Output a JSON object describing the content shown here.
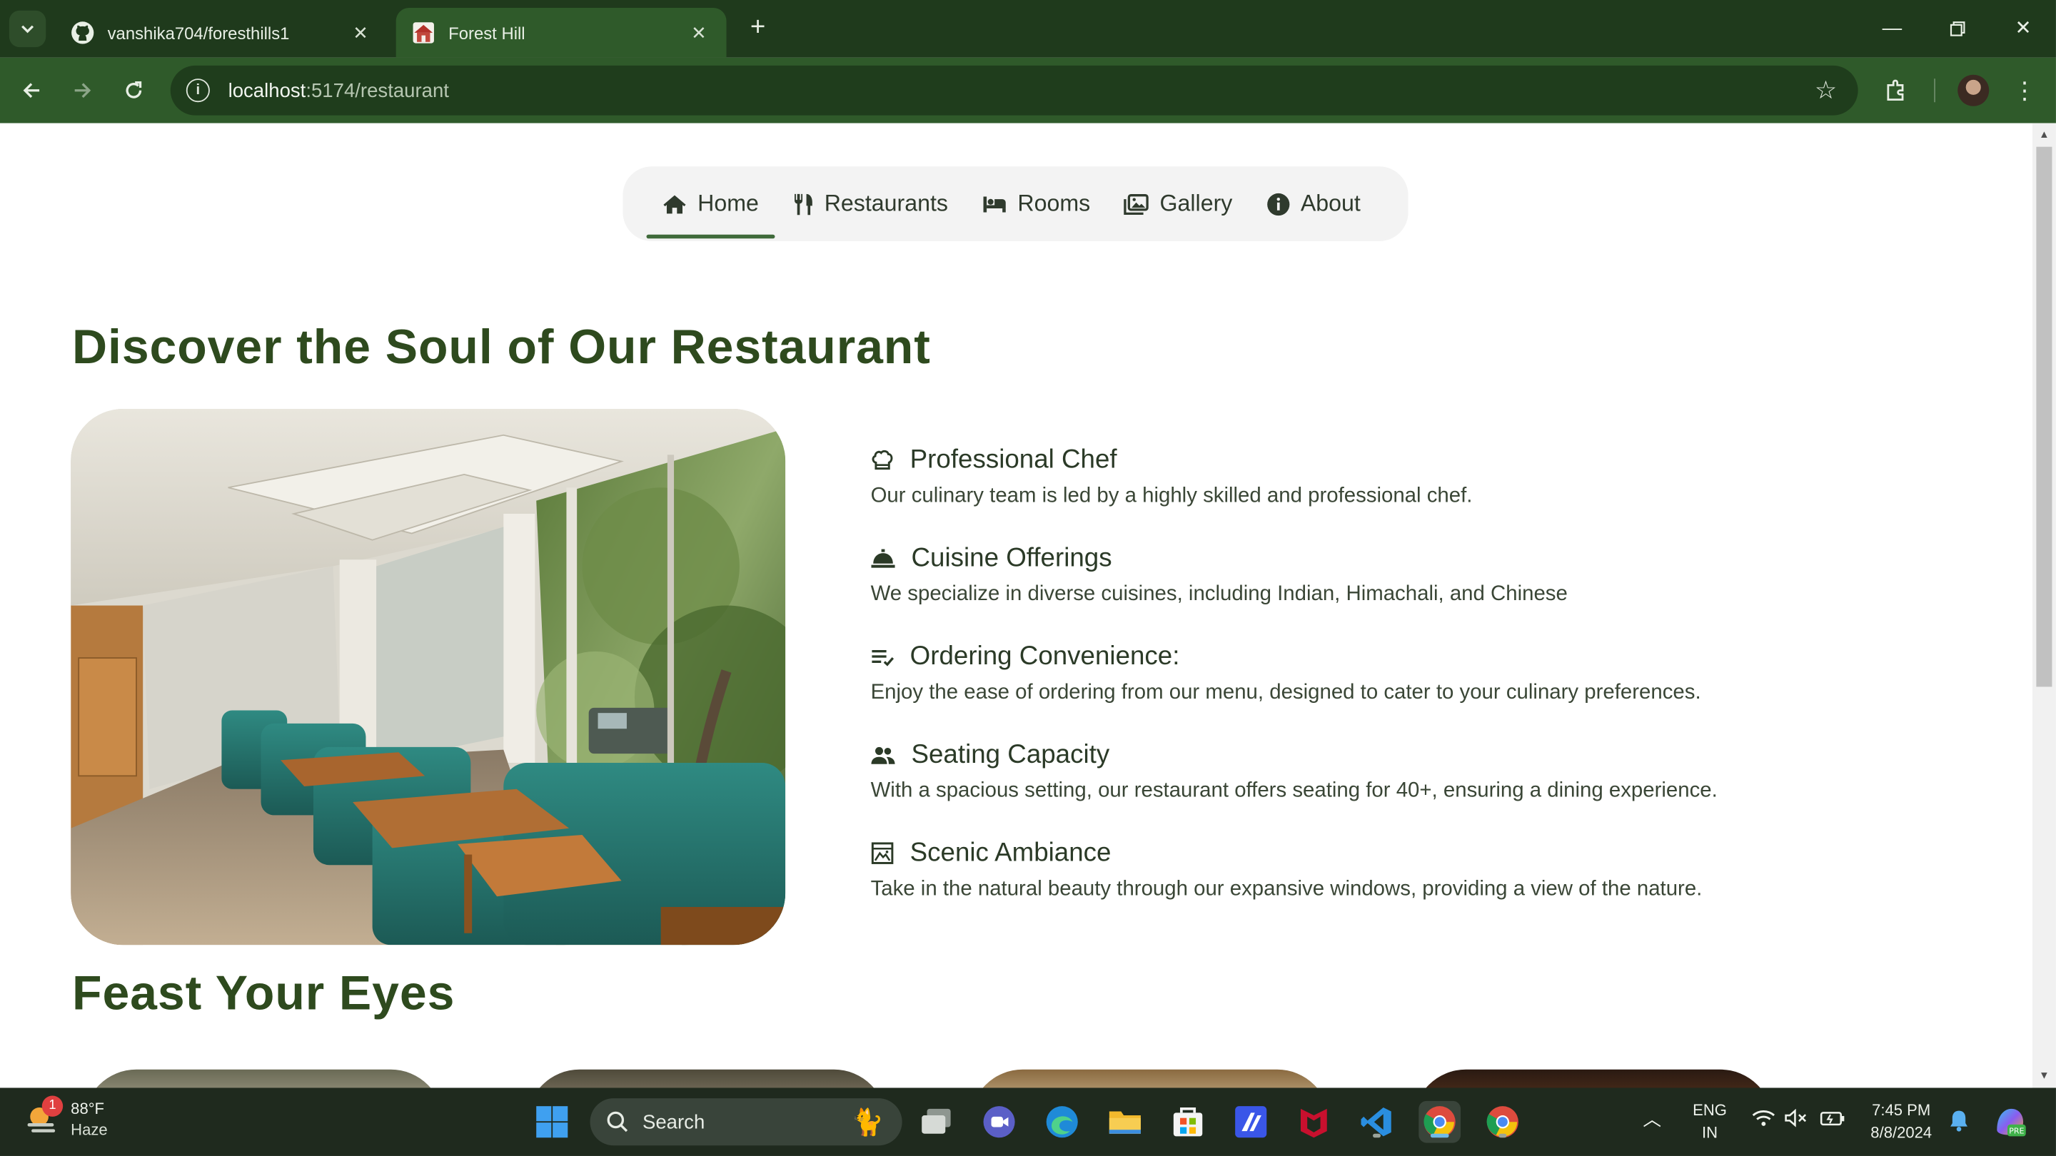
{
  "browser": {
    "tabs": [
      {
        "title": "vanshika704/foresthills1",
        "icon": "github-icon",
        "active": false
      },
      {
        "title": "Forest Hill",
        "icon": "house-favicon-icon",
        "active": true
      }
    ],
    "url_host": "localhost",
    "url_path": ":5174/restaurant",
    "accent": "#2f5a2a",
    "tabstrip_color": "#1f3a1c"
  },
  "site_nav": {
    "items": [
      {
        "label": "Home",
        "icon": "home-icon",
        "active": true
      },
      {
        "label": "Restaurants",
        "icon": "utensils-icon",
        "active": false
      },
      {
        "label": "Rooms",
        "icon": "bed-icon",
        "active": false
      },
      {
        "label": "Gallery",
        "icon": "images-icon",
        "active": false
      },
      {
        "label": "About",
        "icon": "info-circle-icon",
        "active": false
      }
    ]
  },
  "main": {
    "heading": "Discover the Soul of Our Restaurant",
    "heading_color": "#2e4a1e",
    "features": [
      {
        "title": "Professional Chef",
        "desc": "Our culinary team is led by a highly skilled and professional chef.",
        "icon": "chef-hat-icon"
      },
      {
        "title": "Cuisine Offerings",
        "desc": "We specialize in diverse cuisines, including Indian, Himachali, and Chinese",
        "icon": "cloche-icon"
      },
      {
        "title": "Ordering Convenience:",
        "desc": "Enjoy the ease of ordering from our menu, designed to cater to your culinary preferences.",
        "icon": "menu-list-icon"
      },
      {
        "title": "Seating Capacity",
        "desc": "With a spacious setting, our restaurant offers seating for 40+, ensuring a dining experience.",
        "icon": "people-icon"
      },
      {
        "title": "Scenic Ambiance",
        "desc": "Take in the natural beauty through our expansive windows, providing a view of the nature.",
        "icon": "window-view-icon"
      }
    ],
    "gallery_heading": "Feast Your Eyes"
  },
  "taskbar": {
    "weather_temp": "88°F",
    "weather_cond": "Haze",
    "weather_badge": "1",
    "search_label": "Search",
    "lang_top": "ENG",
    "lang_bottom": "IN",
    "time": "7:45 PM",
    "date": "8/8/2024"
  }
}
